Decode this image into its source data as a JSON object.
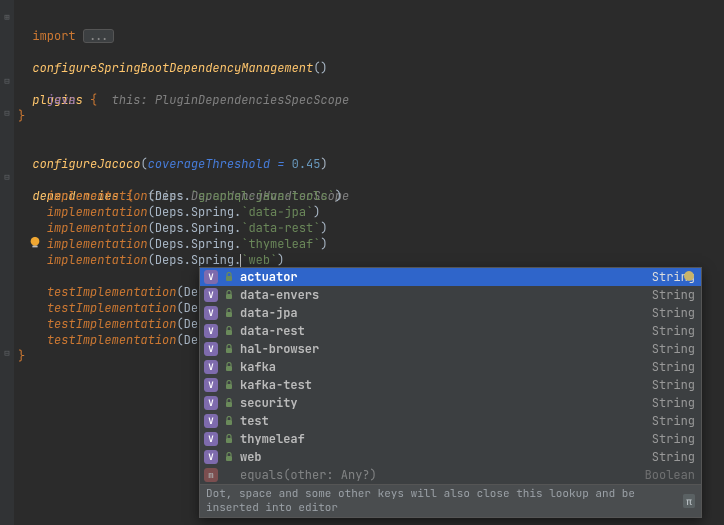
{
  "lines": {
    "import_kw": "import",
    "dots": "...",
    "configSpring": "configureSpringBootDependencyManagement",
    "plugins_kw": "plugins",
    "plugins_hint": "this: PluginDependenciesSpecScope",
    "java": "java",
    "configJacoco": "configureJacoco",
    "coverageParam": "coverageThreshold = ",
    "coverageVal": "0.45",
    "deps_kw": "dependencies",
    "deps_hint": "this: DependencyHandlerScope",
    "impl": "implementation",
    "testImpl": "testImplementation",
    "Deps": "Deps",
    "Spring": "Spring",
    "gql": "graphql-java-tools",
    "djpa": "data-jpa",
    "drest": "data-rest",
    "thyme": "thymeleaf",
    "web": "web"
  },
  "completion": {
    "items": [
      {
        "label": "actuator",
        "type": "String",
        "selected": true
      },
      {
        "label": "data-envers",
        "type": "String",
        "selected": false
      },
      {
        "label": "data-jpa",
        "type": "String",
        "selected": false
      },
      {
        "label": "data-rest",
        "type": "String",
        "selected": false
      },
      {
        "label": "hal-browser",
        "type": "String",
        "selected": false
      },
      {
        "label": "kafka",
        "type": "String",
        "selected": false
      },
      {
        "label": "kafka-test",
        "type": "String",
        "selected": false
      },
      {
        "label": "security",
        "type": "String",
        "selected": false
      },
      {
        "label": "test",
        "type": "String",
        "selected": false
      },
      {
        "label": "thymeleaf",
        "type": "String",
        "selected": false
      },
      {
        "label": "web",
        "type": "String",
        "selected": false
      }
    ],
    "faded": {
      "label": "equals(other: Any?)",
      "type": "Boolean"
    },
    "hint": "Dot, space and some other keys will also close this lookup and be inserted into editor",
    "badge": "V",
    "pi": "π"
  },
  "colors": {
    "bg": "#2b2b2b",
    "selection": "#2f65ca",
    "keyword": "#cc7832",
    "string": "#6a8759",
    "number": "#6897bb"
  }
}
